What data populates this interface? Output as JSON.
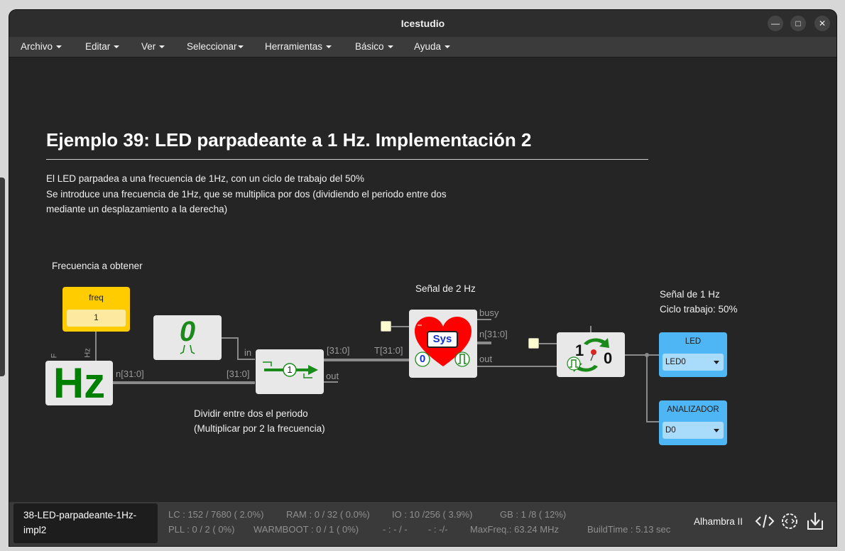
{
  "window": {
    "title": "Icestudio"
  },
  "menu": {
    "items": [
      "Archivo",
      "Editar",
      "Ver",
      "Seleccionar",
      "Herramientas",
      "Básico",
      "Ayuda"
    ]
  },
  "canvas": {
    "heading": "Ejemplo 39: LED parpadeante a 1 Hz. Implementación 2",
    "description": [
      "El LED parpadea a una frecuencia de 1Hz, con un ciclo de trabajo del 50%",
      "Se introduce una frecuencia de 1Hz, que se multiplica por dos (dividiendo el periodo entre dos",
      "mediante un desplazamiento a la derecha)"
    ],
    "label_freq_obtain": "Frecuencia a obtener",
    "label_2hz": "Señal de 2 Hz",
    "label_1hz": [
      "Señal de 1 Hz",
      "Ciclo trabajo: 50%"
    ],
    "label_divide": [
      "Dividir entre dos el periodo",
      "(Multiplicar por 2 la frecuencia)"
    ],
    "freq_block": {
      "title": "freq",
      "value": "1"
    },
    "hz_block": {
      "text": "Hz",
      "port_f": "F",
      "port_hz": "Hz",
      "out_port": "n[31:0]"
    },
    "zero_block": {
      "text": "0"
    },
    "shift_block": {
      "in_port": "in",
      "bus_in": "[31:0]",
      "bus_out": "[31:0]",
      "out_port": "out",
      "shift_value": "1"
    },
    "sys_block": {
      "label": "Sys",
      "bus_in": "T[31:0]",
      "busy_port": "busy",
      "n_port": "n[31:0]",
      "out_port": "out",
      "zero": "0"
    },
    "toggle_block": {
      "one": "1",
      "zero": "0"
    },
    "led_output": {
      "label": "LED",
      "pin": "LED0"
    },
    "analyzer_output": {
      "label": "ANALIZADOR",
      "pin": "D0"
    }
  },
  "status": {
    "project": "38-LED-parpadeante-1Hz-impl2",
    "row1": [
      "LC : 152 / 7680 ( 2.0%)",
      "RAM : 0 / 32 ( 0.0%)",
      "IO :  10 /256  ( 3.9%)",
      "GB :  1 /8  ( 12%)"
    ],
    "row2": [
      "PLL : 0 / 2 ( 0%)",
      "WARMBOOT : 0 / 1 ( 0%)",
      "- : - / -",
      "- :  -/-",
      "MaxFreq.:  63.24 MHz",
      "BuildTime :  5.13 sec"
    ],
    "board": "Alhambra II"
  },
  "icons": [
    "close-icon",
    "maximize-icon",
    "minimize-icon",
    "code-icon",
    "settings-code-icon",
    "download-icon"
  ],
  "colors": {
    "freq_block": "#ffcc00",
    "io_block": "#4fb6f5",
    "hz_green": "#008000",
    "heart_red": "#ff0000"
  }
}
